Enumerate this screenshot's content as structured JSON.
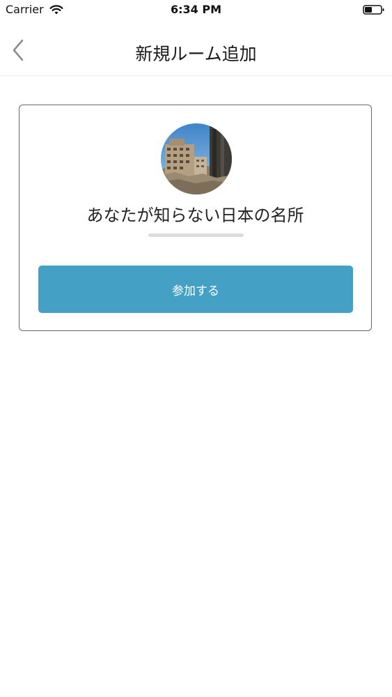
{
  "status_bar": {
    "carrier": "Carrier",
    "time": "6:34 PM",
    "wifi_icon": "wifi-icon",
    "battery_icon": "battery-icon"
  },
  "nav": {
    "title": "新規ルーム追加",
    "back_icon": "chevron-left-icon"
  },
  "room": {
    "name": "あなたが知らない日本の名所",
    "avatar": "room-photo",
    "join_label": "参加する"
  },
  "colors": {
    "accent": "#44a0c4",
    "card_border": "#666666",
    "divider": "#eeeeee"
  }
}
